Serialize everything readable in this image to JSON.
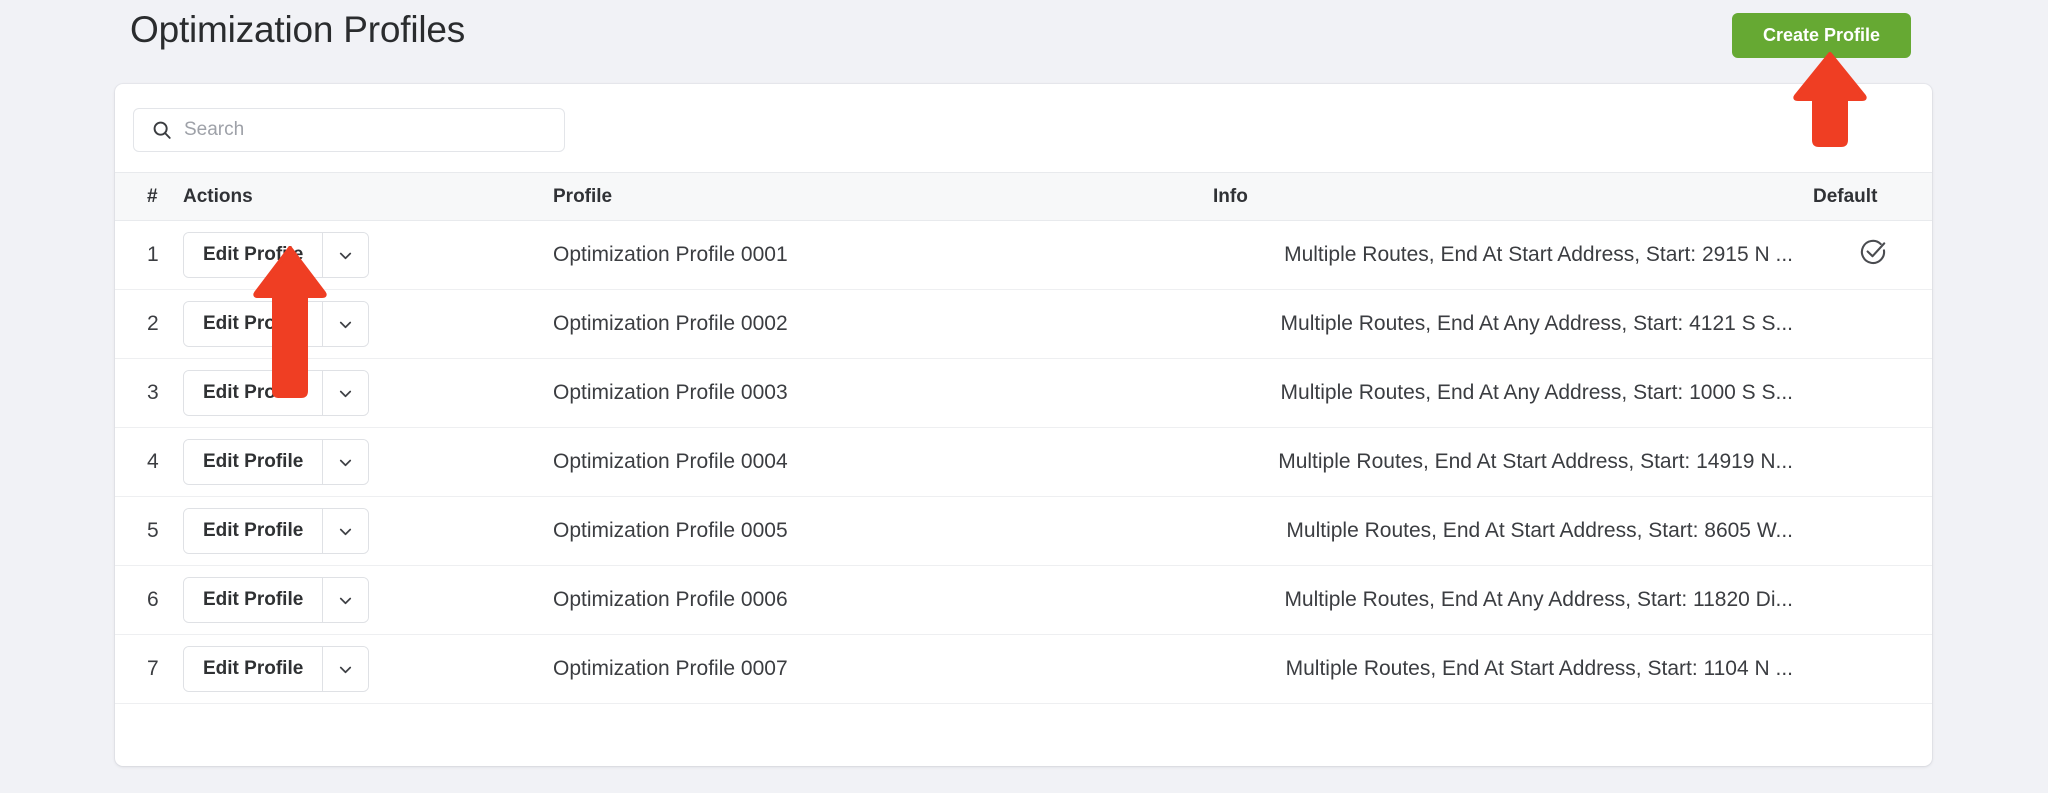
{
  "header": {
    "title": "Optimization Profiles",
    "create_button_label": "Create Profile"
  },
  "search": {
    "placeholder": "Search",
    "value": "",
    "icon": "search-icon"
  },
  "table": {
    "columns": {
      "num": "#",
      "actions": "Actions",
      "profile": "Profile",
      "info": "Info",
      "default": "Default"
    },
    "action_label": "Edit Profile",
    "caret_icon": "chevron-down-icon",
    "default_icon": "check-circle-icon",
    "rows": [
      {
        "num": "1",
        "action": "Edit Profile",
        "profile": "Optimization Profile 0001",
        "info": "Multiple Routes, End At Start Address, Start: 2915 N ...",
        "is_default": true
      },
      {
        "num": "2",
        "action": "Edit Profile",
        "profile": "Optimization Profile 0002",
        "info": "Multiple Routes, End At Any Address, Start: 4121 S S...",
        "is_default": false
      },
      {
        "num": "3",
        "action": "Edit Profile",
        "profile": "Optimization Profile 0003",
        "info": "Multiple Routes, End At Any Address, Start: 1000 S S...",
        "is_default": false
      },
      {
        "num": "4",
        "action": "Edit Profile",
        "profile": "Optimization Profile 0004",
        "info": "Multiple Routes, End At Start Address, Start: 14919 N...",
        "is_default": false
      },
      {
        "num": "5",
        "action": "Edit Profile",
        "profile": "Optimization Profile 0005",
        "info": "Multiple Routes, End At Start Address, Start: 8605 W...",
        "is_default": false
      },
      {
        "num": "6",
        "action": "Edit Profile",
        "profile": "Optimization Profile 0006",
        "info": "Multiple Routes, End At Any Address, Start: 11820 Di...",
        "is_default": false
      },
      {
        "num": "7",
        "action": "Edit Profile",
        "profile": "Optimization Profile 0007",
        "info": "Multiple Routes, End At Start Address, Start: 1104 N ...",
        "is_default": false
      }
    ]
  },
  "annotations": [
    {
      "name": "arrow-create-profile",
      "points_to": "Create Profile"
    },
    {
      "name": "arrow-edit-profile",
      "points_to": "Edit Profile"
    }
  ],
  "colors": {
    "page_background": "#f1f2f6",
    "card_background": "#ffffff",
    "create_button": "#66a933",
    "annotation_arrow": "#ef3e23",
    "header_row": "#f7f8f9",
    "text": "#2f3133"
  }
}
